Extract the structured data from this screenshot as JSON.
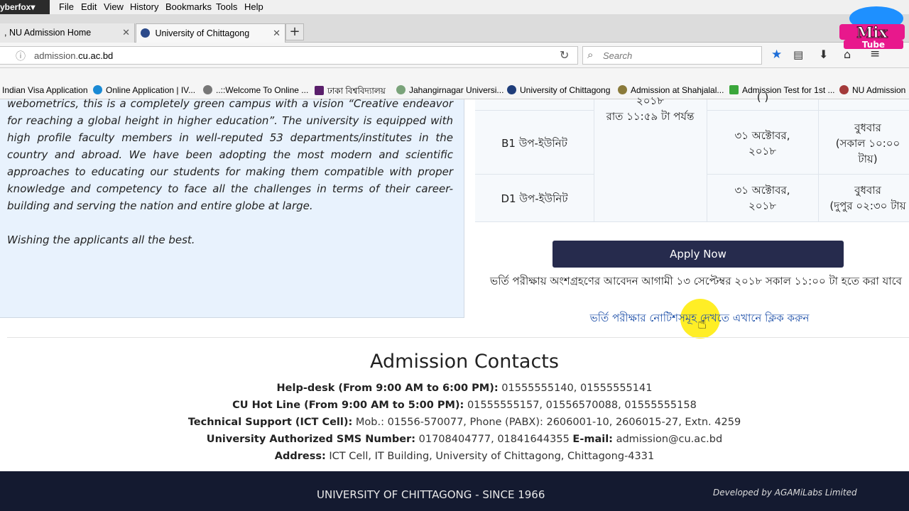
{
  "browser": {
    "app_button": "yberfox▾",
    "menu": [
      "File",
      "Edit",
      "View",
      "History",
      "Bookmarks",
      "Tools",
      "Help"
    ],
    "tabs": [
      {
        "label": ", NU Admission Home"
      },
      {
        "label": "University of Chittagong"
      }
    ],
    "url_domain": "admission.",
    "url_host": "cu.ac.bd",
    "search_placeholder": "Search",
    "bookmarks": [
      {
        "label": "Indian Visa Application",
        "color": "#e07b00"
      },
      {
        "label": "Online Application | IV...",
        "color": "#1a8ad4"
      },
      {
        "label": "..::Welcome To Online ...",
        "color": "#777777"
      },
      {
        "label": "ঢাকা বিশ্ববিদ্যালয়",
        "color": "#5a1f6b"
      },
      {
        "label": "Jahangirnagar Universi...",
        "color": "#7aa37a"
      },
      {
        "label": "University of Chittagong",
        "color": "#1f3d7a"
      },
      {
        "label": "Admission at Shahjalal...",
        "color": "#8a7a3a"
      },
      {
        "label": "Admission Test for 1st ...",
        "color": "#3aa63a"
      },
      {
        "label": "NU Admission",
        "color": "#a33a3a"
      }
    ],
    "watermark": {
      "line1": "Mix",
      "line2": "Tube"
    }
  },
  "intro": {
    "paragraph": "webometrics, this is a completely green campus with a vision “Creative endeavor for reaching a global height in higher education”. The university is equipped with high profile faculty members in well-reputed 53 departments/institutes in the country and abroad. We have been adopting the most modern and scientific approaches to educating our students for making them compatible with proper knowledge and competency to face all the challenges in terms of their career-building and serving the nation and entire globe at large.",
    "closing": "Wishing the applicants all the best."
  },
  "schedule": {
    "row0": {
      "deadline_top": "২০১৮",
      "deadline": "রাত ১১:৫৯ টা পর্যন্ত"
    },
    "rows": [
      {
        "unit": "B1 উপ-ইউনিট",
        "date_line1": "৩১ অক্টোবর,",
        "date_line2": "২০১৮",
        "time_line1": "বুধবার",
        "time_line2": "(সকাল ১০:০০",
        "time_line3": "টায়)"
      },
      {
        "unit": "D1 উপ-ইউনিট",
        "date_line1": "৩১ অক্টোবর,",
        "date_line2": "২০১৮",
        "time_line1": "বুধবার",
        "time_line2": "(দুপুর ০২:৩০ টায়",
        "time_line3": ""
      }
    ]
  },
  "apply_button": "Apply Now",
  "notice_text": "ভর্তি পরীক্ষায় অংশগ্রহণের আবেদন আগামী ১৩ সেপ্টেম্বর ২০১৮ সকাল ১১:০০ টা হতে করা যাবে",
  "notice_link": "ভর্তি পরীক্ষার নোটিশসমূহ দেখতে এখানে ক্লিক করুন",
  "contacts": {
    "title": "Admission Contacts",
    "helpdesk_label": "Help-desk (From 9:00 AM to 6:00 PM):",
    "helpdesk_value": " 01555555140, 01555555141",
    "hotline_label": "CU Hot Line (From 9:00 AM to 5:00 PM):",
    "hotline_value": " 01555555157, 01556570088, 01555555158",
    "tech_label": "Technical Support (ICT Cell):",
    "tech_value": " Mob.: 01556-570077, Phone (PABX): 2606001-10, 2606015-27, Extn. 4259",
    "sms_label": "University Authorized SMS Number:",
    "sms_value": " 01708404777, 01841644355 ",
    "email_label": "E-mail:",
    "email_value": " admission@cu.ac.bd",
    "address_label": "Address:",
    "address_value": " ICT Cell, IT Building, University of Chittagong, Chittagong-4331"
  },
  "footer": {
    "text": "UNIVERSITY OF CHITTAGONG - SINCE 1966",
    "developer": "Developed by AGAMiLabs Limited"
  }
}
